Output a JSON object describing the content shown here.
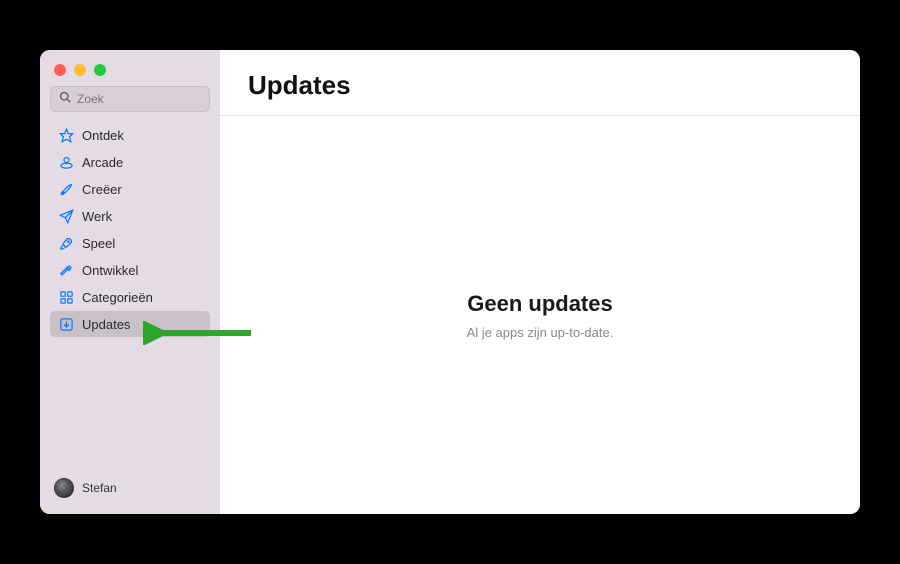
{
  "search": {
    "placeholder": "Zoek"
  },
  "sidebar": {
    "items": [
      {
        "label": "Ontdek"
      },
      {
        "label": "Arcade"
      },
      {
        "label": "Creëer"
      },
      {
        "label": "Werk"
      },
      {
        "label": "Speel"
      },
      {
        "label": "Ontwikkel"
      },
      {
        "label": "Categorieën"
      },
      {
        "label": "Updates"
      }
    ]
  },
  "user": {
    "name": "Stefan"
  },
  "main": {
    "title": "Updates",
    "empty_title": "Geen updates",
    "empty_subtitle": "Al je apps zijn up-to-date."
  },
  "colors": {
    "accent": "#0a7aff"
  }
}
